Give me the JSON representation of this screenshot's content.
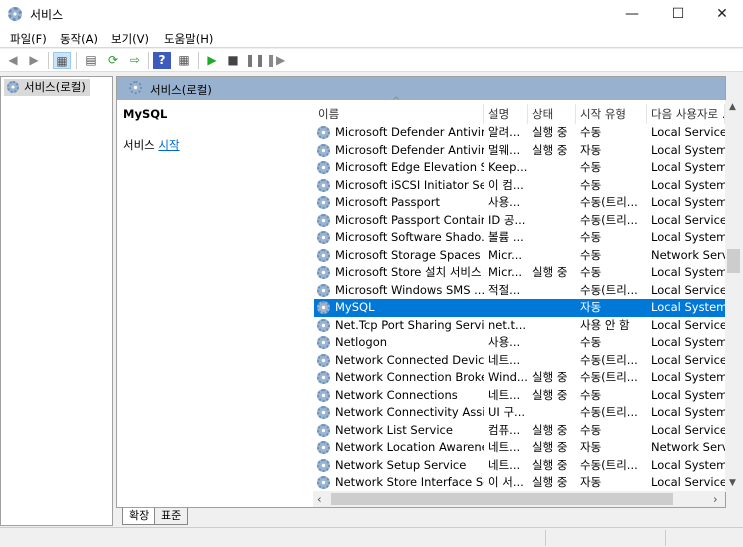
{
  "window": {
    "title": "서비스",
    "minimize": "—",
    "maximize": "☐",
    "close": "✕"
  },
  "menu": [
    "파일(F)",
    "동작(A)",
    "보기(V)",
    "도움말(H)"
  ],
  "toolbar": {
    "icons": [
      "back-icon",
      "forward-icon",
      "console-tree-icon",
      "properties-icon",
      "refresh-icon",
      "export-icon",
      "help-icon",
      "action-pane-icon",
      "play-icon",
      "stop-icon",
      "pause-icon",
      "resume-icon"
    ]
  },
  "tree": {
    "item": "서비스(로컬)"
  },
  "pane": {
    "header": "서비스(로컬)",
    "selected_name": "MySQL",
    "action_prefix": "서비스 ",
    "action_link": "시작"
  },
  "columns": [
    "이름",
    "설명",
    "상태",
    "시작 유형",
    "다음 사용자로 ..."
  ],
  "rows": [
    [
      "Microsoft Defender Antivir...",
      "알려...",
      "실행 중",
      "수동",
      "Local Service"
    ],
    [
      "Microsoft Defender Antivir...",
      "멀웨...",
      "실행 중",
      "자동",
      "Local System"
    ],
    [
      "Microsoft Edge Elevation S...",
      "Keep...",
      "",
      "수동",
      "Local System"
    ],
    [
      "Microsoft iSCSI Initiator Se...",
      "이 컴...",
      "",
      "수동",
      "Local System"
    ],
    [
      "Microsoft Passport",
      "사용...",
      "",
      "수동(트리...",
      "Local System"
    ],
    [
      "Microsoft Passport Container",
      "ID 공...",
      "",
      "수동(트리...",
      "Local Service"
    ],
    [
      "Microsoft Software Shado...",
      "볼륨 ...",
      "",
      "수동",
      "Local System"
    ],
    [
      "Microsoft Storage Spaces ...",
      "Micr...",
      "",
      "수동",
      "Network Service"
    ],
    [
      "Microsoft Store 설치 서비스",
      "Micr...",
      "실행 중",
      "수동",
      "Local System"
    ],
    [
      "Microsoft Windows SMS ...",
      "적절...",
      "",
      "수동(트리...",
      "Local Service"
    ],
    [
      "MySQL",
      "",
      "",
      "자동",
      "Local System"
    ],
    [
      "Net.Tcp Port Sharing Service",
      "net.t...",
      "",
      "사용 안 함",
      "Local Service"
    ],
    [
      "Netlogon",
      "사용...",
      "",
      "수동",
      "Local System"
    ],
    [
      "Network Connected Device...",
      "네트...",
      "",
      "수동(트리...",
      "Local Service"
    ],
    [
      "Network Connection Broker",
      "Wind...",
      "실행 중",
      "수동(트리...",
      "Local System"
    ],
    [
      "Network Connections",
      "네트...",
      "실행 중",
      "수동",
      "Local System"
    ],
    [
      "Network Connectivity Assis...",
      "UI 구...",
      "",
      "수동(트리...",
      "Local System"
    ],
    [
      "Network List Service",
      "컴퓨...",
      "실행 중",
      "수동",
      "Local Service"
    ],
    [
      "Network Location Awareness",
      "네트...",
      "실행 중",
      "자동",
      "Network Service"
    ],
    [
      "Network Setup Service",
      "네트...",
      "실행 중",
      "수동(트리...",
      "Local System"
    ],
    [
      "Network Store Interface Se...",
      "이 서...",
      "실행 중",
      "자동",
      "Local Service"
    ]
  ],
  "selected_row": 10,
  "tabs": [
    "확장",
    "표준"
  ],
  "colors": {
    "selection": "#0078d7",
    "pane_header": "#97b1cf",
    "link": "#0066cc"
  }
}
